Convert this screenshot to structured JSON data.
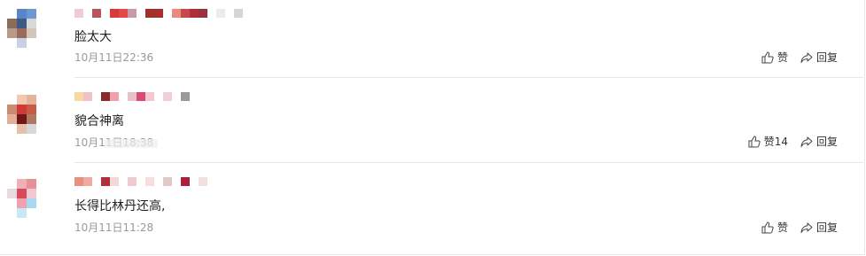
{
  "comments": [
    {
      "text": "脸太大",
      "time": "10月11日22:36",
      "like_label": "赞",
      "reply_label": "回复",
      "avatar_colors": [
        "#ffffff",
        "#5a86c9",
        "#6d97d3",
        "#ffffff",
        "#8a6c5a",
        "#3a5a88",
        "#d8d8d8",
        "#ffffff",
        "#b89a88",
        "#9a6b5a",
        "#d3c5b8",
        "#ffffff",
        "#ffffff",
        "#c7d3e2",
        "#ffffff",
        "#ffffff"
      ],
      "name_colors": [
        "#f2c9d6",
        "#ffffff",
        "#b8545e",
        "#ffffff",
        "#d83a3a",
        "#e04a4a",
        "#c89aa4",
        "#ffffff",
        "#a0322a",
        "#a8302a",
        "#ffffff",
        "#e88a80",
        "#c44b4b",
        "#b02e3a",
        "#9b3040",
        "#ffffff",
        "#ececec",
        "#ffffff",
        "#d6d6d6"
      ]
    },
    {
      "text": "貌合神离",
      "time": "10月11日18:38",
      "like_label": "赞14",
      "reply_label": "回复",
      "avatar_colors": [
        "#ffffff",
        "#f2c8b0",
        "#e8b29a",
        "#ffffff",
        "#c88c70",
        "#d23a3a",
        "#c85a48",
        "#ffffff",
        "#e0b09a",
        "#701818",
        "#b07860",
        "#ffffff",
        "#ffffff",
        "#e8c0a8",
        "#d8d8d8",
        "#ffffff"
      ],
      "name_colors": [
        "#f5d9a0",
        "#f2c0c8",
        "#ffffff",
        "#8a2a2a",
        "#f0a0a8",
        "#ffffff",
        "#e8c0c8",
        "#d84a7a",
        "#f5c8d0",
        "#ffffff",
        "#f0d0d8",
        "#ffffff",
        "#9a9a9a"
      ]
    },
    {
      "text": "长得比林丹还高,",
      "time": "10月11日11:28",
      "like_label": "赞",
      "reply_label": "回复",
      "avatar_colors": [
        "#ffffff",
        "#f0b0b8",
        "#e89098",
        "#ffffff",
        "#e8d8e0",
        "#d84a5a",
        "#f0c8d0",
        "#ffffff",
        "#ffffff",
        "#f0a0b0",
        "#a8d8f0",
        "#ffffff",
        "#ffffff",
        "#c8e8f8",
        "#ffffff",
        "#ffffff"
      ],
      "name_colors": [
        "#e89080",
        "#f0a8a0",
        "#ffffff",
        "#b0303a",
        "#f2d8d8",
        "#ffffff",
        "#f0c8d0",
        "#ffffff",
        "#f5dde0",
        "#ffffff",
        "#e0c8c8",
        "#ffffff",
        "#a8203a",
        "#ffffff",
        "#f2e0e0"
      ]
    }
  ]
}
